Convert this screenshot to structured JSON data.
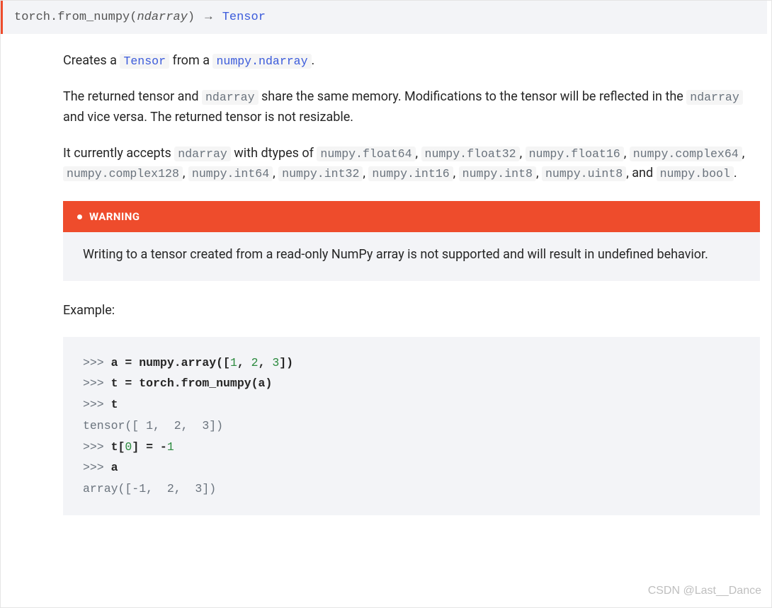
{
  "signature": {
    "prefix": "torch.",
    "name": "from_numpy",
    "arg": "ndarray",
    "arrow": "→",
    "return_type": "Tensor"
  },
  "paragraphs": {
    "p1_pre": "Creates a ",
    "p1_link1": "Tensor",
    "p1_mid": " from a ",
    "p1_link2": "numpy.ndarray",
    "p1_end": ".",
    "p2_pre": "The returned tensor and ",
    "p2_code1": "ndarray",
    "p2_mid": " share the same memory. Modifications to the tensor will be reflected in the ",
    "p2_code2": "ndarray",
    "p2_end": " and vice versa. The returned tensor is not resizable.",
    "p3_pre": "It currently accepts ",
    "p3_c0": "ndarray",
    "p3_t1": " with dtypes of ",
    "p3_c1": "numpy.float64",
    "p3_c2": "numpy.float32",
    "p3_c3": "numpy.float16",
    "p3_c4": "numpy.complex64",
    "p3_c5": "numpy.complex128",
    "p3_c6": "numpy.int64",
    "p3_c7": "numpy.int32",
    "p3_c8": "numpy.int16",
    "p3_c9": "numpy.int8",
    "p3_c10": "numpy.uint8",
    "p3_and": ", and ",
    "p3_c11": "numpy.bool",
    "p3_end": "."
  },
  "warning": {
    "title": "WARNING",
    "body": "Writing to a tensor created from a read-only NumPy array is not supported and will result in undefined behavior."
  },
  "example_label": "Example:",
  "code": {
    "l1_prompt": ">>> ",
    "l1_body1": "a = numpy.array([",
    "l1_n1": "1",
    "l1_n2": "2",
    "l1_n3": "3",
    "l1_body2": "])",
    "l2_prompt": ">>> ",
    "l2_body": "t = torch.from_numpy(a)",
    "l3_prompt": ">>> ",
    "l3_body": "t",
    "l4_out": "tensor([ 1,  2,  3])",
    "l5_prompt": ">>> ",
    "l5_a": "t[",
    "l5_i": "0",
    "l5_b": "] = -",
    "l5_n": "1",
    "l6_prompt": ">>> ",
    "l6_body": "a",
    "l7_out": "array([-1,  2,  3])"
  },
  "watermark": "CSDN @Last__Dance"
}
